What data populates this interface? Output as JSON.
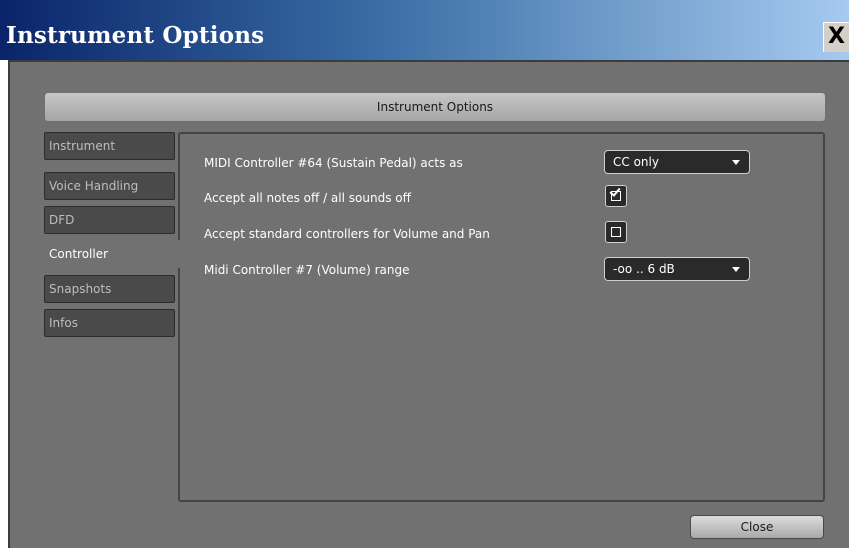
{
  "window": {
    "title": "Instrument Options",
    "close_glyph": "X",
    "header": "Instrument Options"
  },
  "tabs": [
    {
      "label": "Instrument",
      "active": false
    },
    {
      "label": "Voice Handling",
      "active": false
    },
    {
      "label": "DFD",
      "active": false
    },
    {
      "label": "Controller",
      "active": true
    },
    {
      "label": "Snapshots",
      "active": false
    },
    {
      "label": "Infos",
      "active": false
    }
  ],
  "controller": {
    "sustain_label": "MIDI Controller #64 (Sustain Pedal) acts as",
    "sustain_value": "CC only",
    "notes_off_label": "Accept all notes off / all sounds off",
    "notes_off_checked": true,
    "standard_ctrl_label": "Accept standard controllers for Volume and Pan",
    "standard_ctrl_checked": false,
    "volume_range_label": "Midi Controller #7 (Volume) range",
    "volume_range_value": "-oo .. 6 dB"
  },
  "footer": {
    "close_label": "Close"
  },
  "colors": {
    "title_bar_start": "#0a246a",
    "title_bar_end": "#a6caf0",
    "panel_bg": "#717171",
    "tab_bg": "#4a4a4a",
    "control_bg": "#2a2a2a"
  },
  "icons": {
    "close": "close-icon",
    "dropdown": "chevron-down-icon",
    "check": "checkmark-icon"
  }
}
